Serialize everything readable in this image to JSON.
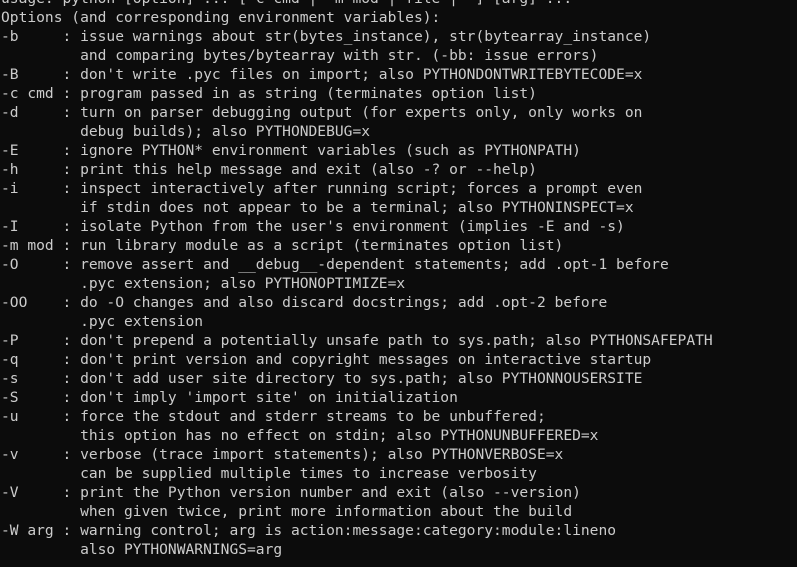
{
  "terminal": {
    "lines": [
      "usage: python [option] ... [-c cmd | -m mod | file | -] [arg] ...",
      "Options (and corresponding environment variables):",
      "-b     : issue warnings about str(bytes_instance), str(bytearray_instance)",
      "         and comparing bytes/bytearray with str. (-bb: issue errors)",
      "-B     : don't write .pyc files on import; also PYTHONDONTWRITEBYTECODE=x",
      "-c cmd : program passed in as string (terminates option list)",
      "-d     : turn on parser debugging output (for experts only, only works on",
      "         debug builds); also PYTHONDEBUG=x",
      "-E     : ignore PYTHON* environment variables (such as PYTHONPATH)",
      "-h     : print this help message and exit (also -? or --help)",
      "-i     : inspect interactively after running script; forces a prompt even",
      "         if stdin does not appear to be a terminal; also PYTHONINSPECT=x",
      "-I     : isolate Python from the user's environment (implies -E and -s)",
      "-m mod : run library module as a script (terminates option list)",
      "-O     : remove assert and __debug__-dependent statements; add .opt-1 before",
      "         .pyc extension; also PYTHONOPTIMIZE=x",
      "-OO    : do -O changes and also discard docstrings; add .opt-2 before",
      "         .pyc extension",
      "-P     : don't prepend a potentially unsafe path to sys.path; also PYTHONSAFEPATH",
      "-q     : don't print version and copyright messages on interactive startup",
      "-s     : don't add user site directory to sys.path; also PYTHONNOUSERSITE",
      "-S     : don't imply 'import site' on initialization",
      "-u     : force the stdout and stderr streams to be unbuffered;",
      "         this option has no effect on stdin; also PYTHONUNBUFFERED=x",
      "-v     : verbose (trace import statements); also PYTHONVERBOSE=x",
      "         can be supplied multiple times to increase verbosity",
      "-V     : print the Python version number and exit (also --version)",
      "         when given twice, print more information about the build",
      "-W arg : warning control; arg is action:message:category:module:lineno",
      "         also PYTHONWARNINGS=arg"
    ]
  },
  "colors": {
    "background": "#0c0c0c",
    "foreground": "#cccccc"
  }
}
